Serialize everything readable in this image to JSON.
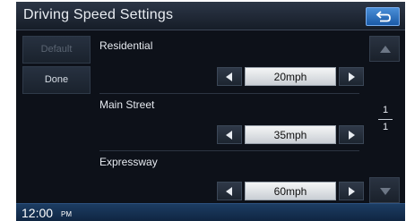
{
  "window": {
    "title": "Driving Speed Settings"
  },
  "side_buttons": {
    "default_label": "Default",
    "done_label": "Done"
  },
  "settings": [
    {
      "label": "Residential",
      "value": "20mph"
    },
    {
      "label": "Main Street",
      "value": "35mph"
    },
    {
      "label": "Expressway",
      "value": "60mph"
    }
  ],
  "pagination": {
    "current": "1",
    "total": "1"
  },
  "status": {
    "time": "12:00",
    "ampm": "PM"
  },
  "icons": {
    "back": "back-arrow-icon",
    "decrease": "arrow-left-icon",
    "increase": "arrow-right-icon",
    "scroll_up": "triangle-up-icon",
    "scroll_down": "triangle-down-icon"
  },
  "colors": {
    "accent": "#2f78c8",
    "background": "#0d1119",
    "value_box": "#eceef0"
  }
}
